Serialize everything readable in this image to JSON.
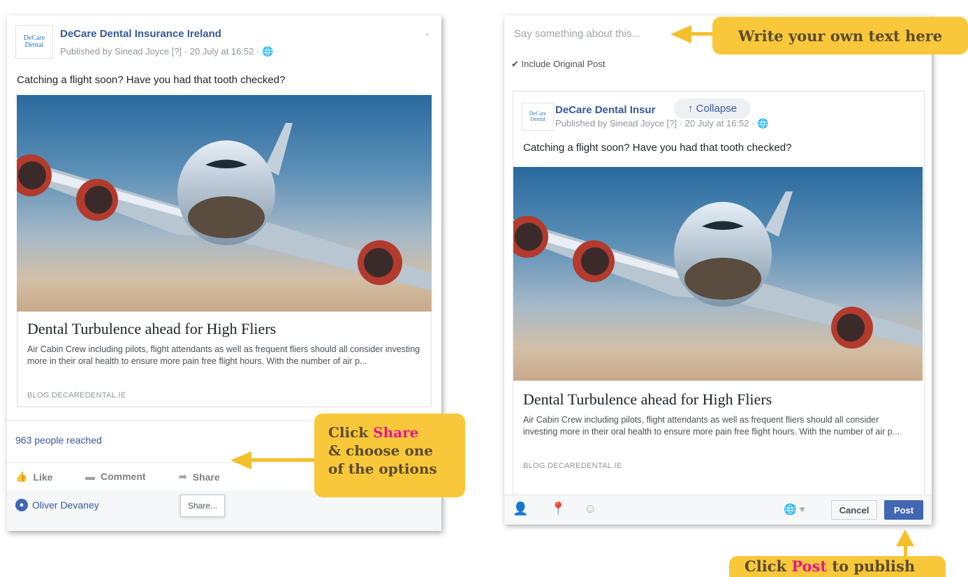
{
  "left_post": {
    "logo": {
      "line1": "DeCare",
      "line2": "Dental"
    },
    "page_name": "DeCare Dental Insurance Ireland",
    "meta": "Published by Sinead Joyce [?] · 20 July at 16:52 · ",
    "text": "Catching a flight soon? Have you had that tooth checked?",
    "link": {
      "title": "Dental Turbulence ahead for High Fliers",
      "description": "Air Cabin Crew including pilots, flight attendants as well as frequent fliers should all consider investing more in their oral health to ensure more pain free flight hours. With the number of air p...",
      "domain": "BLOG.DECAREDENTAL.IE"
    },
    "reached": "963 people reached",
    "actions": {
      "like": "Like",
      "comment": "Comment",
      "share": "Share"
    },
    "commenter": "Oliver Devaney",
    "share_tooltip": "Share..."
  },
  "callout_share": {
    "line1_pre": "Click ",
    "line1_hl": "Share",
    "line2": "& choose one",
    "line3": "of the options"
  },
  "right_post": {
    "say_placeholder": "Say something about this...",
    "include_original": "Include Original Post",
    "logo": {
      "line1": "DeCare",
      "line2": "Dental"
    },
    "page_name": "DeCare Dental Insur",
    "collapse": "↑ Collapse",
    "meta": "Published by Sinead Joyce [?] · 20 July at 16:52 · ",
    "text": "Catching a flight soon? Have you had that tooth checked?",
    "link": {
      "title": "Dental Turbulence ahead for High Fliers",
      "description": "Air Cabin Crew including pilots, flight attendants as well as frequent fliers should all consider investing more in their oral health to ensure more pain free flight hours. With the number of air p...",
      "domain": "BLOG.DECAREDENTAL.IE"
    },
    "cancel_label": "Cancel",
    "post_label": "Post"
  },
  "callout_write": {
    "text": "Write your own text here"
  },
  "callout_post": {
    "pre": "Click ",
    "hl": "Post",
    "post": " to publish"
  },
  "colors": {
    "callout": "#f8c83a",
    "highlight": "#e5188f",
    "fb_blue": "#4267b2"
  }
}
